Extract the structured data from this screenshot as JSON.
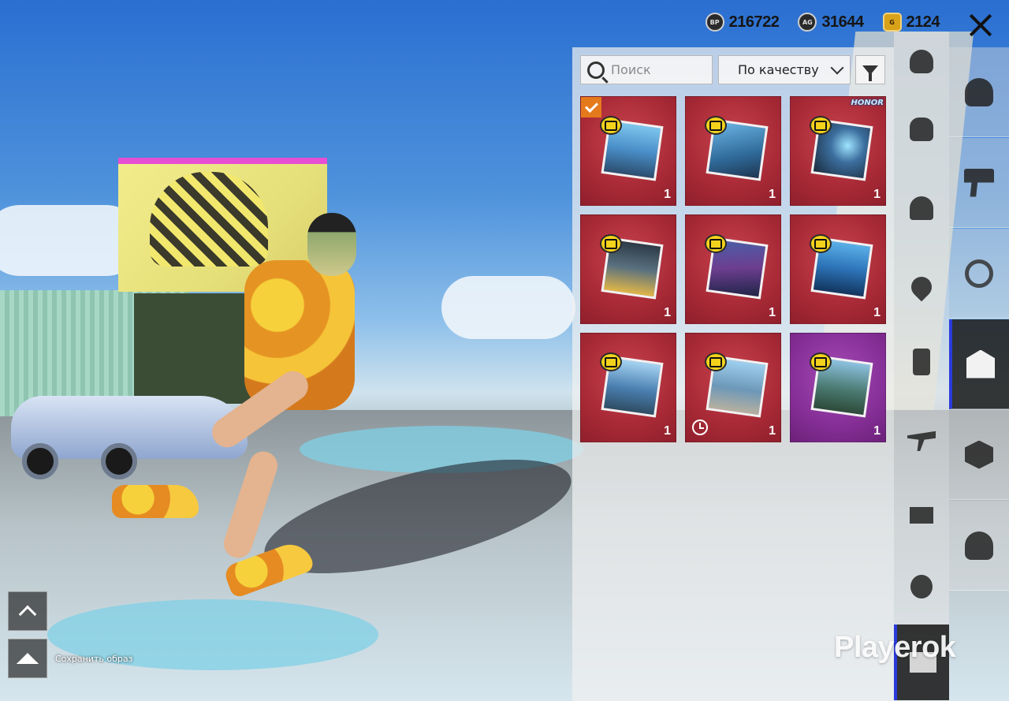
{
  "currencies": [
    {
      "icon": "bp-coin-icon",
      "icon_text": "BP",
      "value": "216722"
    },
    {
      "icon": "silver-fragment-icon",
      "icon_text": "AG",
      "value": "31644"
    },
    {
      "icon": "gold-coin-icon",
      "icon_text": "G",
      "value": "2124"
    }
  ],
  "search": {
    "placeholder": "Поиск"
  },
  "sort": {
    "label": "По качеству"
  },
  "items": [
    {
      "qty": "1",
      "rarity": "red",
      "selected": true,
      "tag": "",
      "timer": false
    },
    {
      "qty": "1",
      "rarity": "red",
      "selected": false,
      "tag": "",
      "timer": false
    },
    {
      "qty": "1",
      "rarity": "red",
      "selected": false,
      "tag": "HONOR",
      "timer": false
    },
    {
      "qty": "1",
      "rarity": "red",
      "selected": false,
      "tag": "",
      "timer": false
    },
    {
      "qty": "1",
      "rarity": "red",
      "selected": false,
      "tag": "",
      "timer": false
    },
    {
      "qty": "1",
      "rarity": "red",
      "selected": false,
      "tag": "",
      "timer": false
    },
    {
      "qty": "1",
      "rarity": "red",
      "selected": false,
      "tag": "",
      "timer": false
    },
    {
      "qty": "1",
      "rarity": "red",
      "selected": false,
      "tag": "",
      "timer": true
    },
    {
      "qty": "1",
      "rarity": "purple",
      "selected": false,
      "tag": "",
      "timer": false
    }
  ],
  "subcategories": [
    "emote-icon",
    "fist-icon",
    "parachute-icon",
    "location-pin-icon",
    "phone-icon",
    "plane-icon",
    "gift-icon",
    "grenade-icon",
    "photo-icon"
  ],
  "categories": [
    "character-icon",
    "gun-icon",
    "steering-wheel-icon",
    "outfit-icon",
    "crate-icon",
    "companion-icon"
  ],
  "save_outfit": {
    "label": "Сохранить образ"
  },
  "watermark": "Playerok",
  "colors": {
    "accent": "#2a3bdc",
    "rarity_red": "#a82a36",
    "rarity_purple": "#862f97",
    "check": "#e57a1c"
  }
}
